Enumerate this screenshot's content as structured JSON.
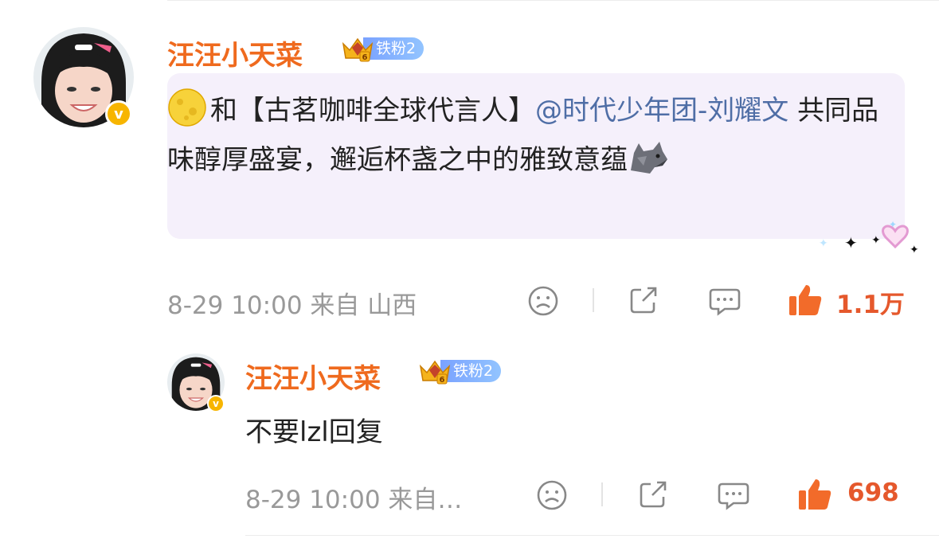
{
  "comment": {
    "username": "汪汪小天菜",
    "fan_badge": "铁粉2",
    "text_before": "和【古茗咖啡全球代言人】",
    "mention": "@时代少年团-刘耀文",
    "text_after": " 共同品味醇厚盛宴，邂逅杯盏之中的雅致意蕴",
    "meta": "8-29 10:00 来自 山西",
    "like_count": "1.1万",
    "icons": [
      "moon-emoji",
      "wolf-emoji",
      "dislike-face-icon",
      "share-icon",
      "comment-icon",
      "thumbs-up-icon",
      "heart-decoration-icon"
    ]
  },
  "reply": {
    "username": "汪汪小天菜",
    "fan_badge": "铁粉2",
    "text": "不要lzl回复",
    "meta": "8-29 10:00 来自…",
    "like_count": "698"
  },
  "colors": {
    "username": "#ef6a1e",
    "mention": "#4f6ea6",
    "like": "#e5582c",
    "bubble": "#f5f0fb",
    "badge": "#7aa2ff",
    "verified": "#f7b500"
  }
}
